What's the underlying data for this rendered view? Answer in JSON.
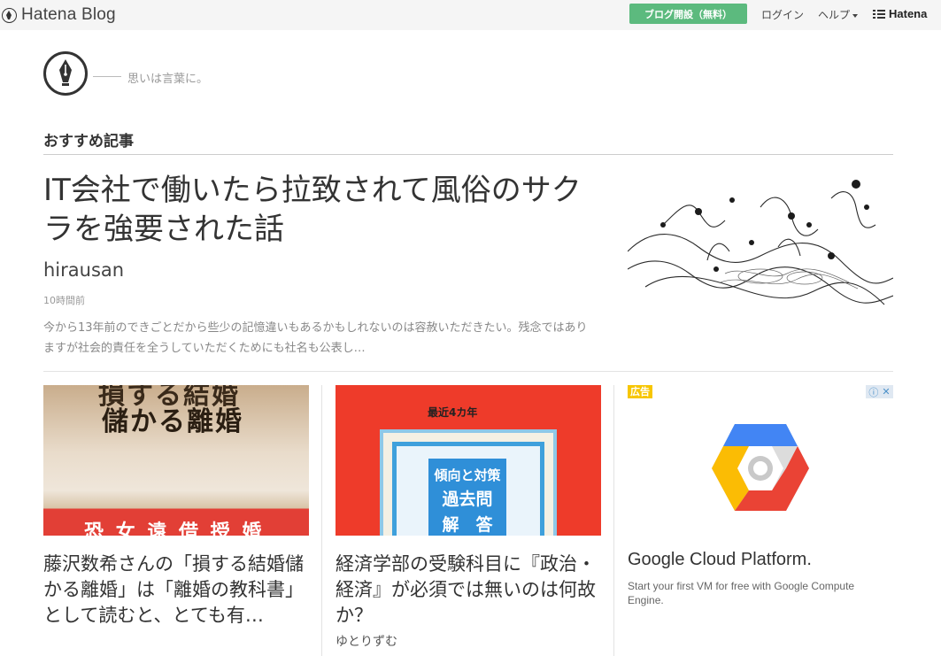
{
  "topbar": {
    "brand": "Hatena Blog",
    "start_button": "ブログ開設（無料）",
    "login": "ログイン",
    "help": "ヘルプ",
    "hatena": "Hatena"
  },
  "blog": {
    "tagline": "思いは言葉に。"
  },
  "section": {
    "title": "おすすめ記事"
  },
  "featured": {
    "title": "IT会社で働いたら拉致されて風俗のサクラを強要された話",
    "author": "hirausan",
    "time": "10時間前",
    "excerpt": "今から13年前のできごとだから些少の記憶違いもあるかもしれないのは容赦いただきたい。残念ではありますが社会的責任を全うしていただくためにも社名も公表し…"
  },
  "cards": [
    {
      "thumb_top": "損する結婚",
      "thumb_main": "儲かる離婚",
      "thumb_bottom": "恐 女 遠 借 授 婚",
      "title": "藤沢数希さんの「損する結婚儲かる離婚」は「離婚の教科書」として読むと、とても有…",
      "author": ""
    },
    {
      "thumb_top": "最近4カ年",
      "thumb_lines": [
        "傾向と対策",
        "過去問",
        "解　答"
      ],
      "title": "経済学部の受験科目に『政治・経済』が必須では無いのは何故か？",
      "author": "ゆとりずむ"
    }
  ],
  "ad": {
    "badge": "広告",
    "title": "Google Cloud Platform.",
    "description": "Start your first VM for free with Google Compute Engine."
  }
}
